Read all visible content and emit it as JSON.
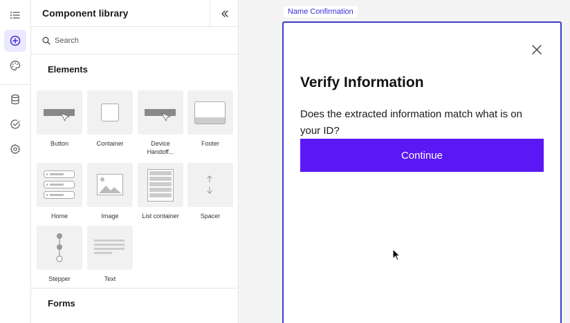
{
  "rail": {
    "items": [
      {
        "icon": "list-icon"
      },
      {
        "icon": "add-circle-icon",
        "active": true
      },
      {
        "icon": "palette-icon"
      },
      {
        "icon": "database-icon"
      },
      {
        "icon": "check-circle-icon"
      },
      {
        "icon": "gear-icon"
      }
    ],
    "accent": "#ebe8ff"
  },
  "library": {
    "title": "Component library",
    "search_placeholder": "Search",
    "elements_heading": "Elements",
    "forms_heading": "Forms",
    "elements": [
      {
        "label": "Button"
      },
      {
        "label": "Container"
      },
      {
        "label": "Device Handoff..."
      },
      {
        "label": "Footer"
      },
      {
        "label": "Home"
      },
      {
        "label": "Image"
      },
      {
        "label": "List container"
      },
      {
        "label": "Spacer"
      },
      {
        "label": "Stepper"
      },
      {
        "label": "Text"
      }
    ]
  },
  "canvas": {
    "frame_tag": "Name Confirmation",
    "title": "Verify Information",
    "body": "Does the extracted information match what is on your ID?",
    "continue_label": "Continue",
    "primary_color": "#5b18f5",
    "frame_color": "#3b3bcc"
  }
}
